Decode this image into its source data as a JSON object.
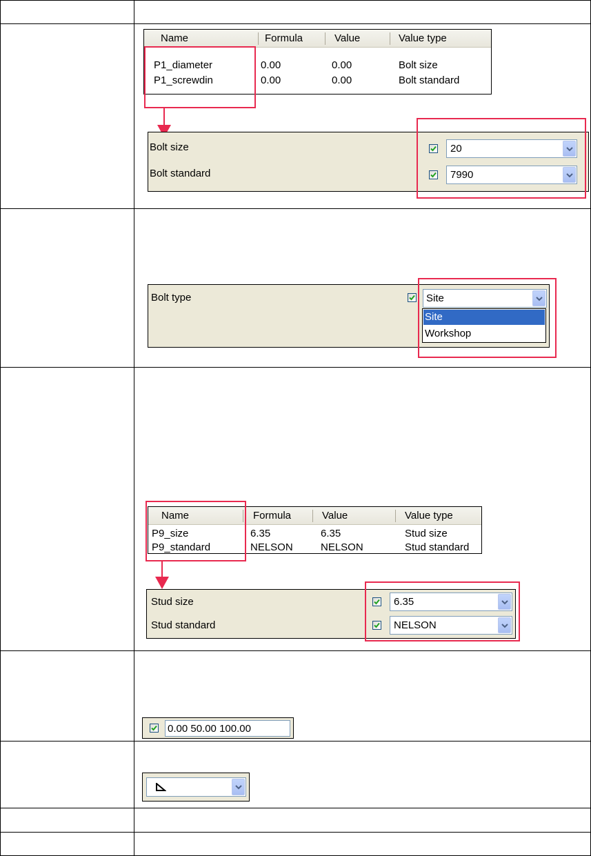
{
  "table1": {
    "headers": [
      "Name",
      "Formula",
      "Value",
      "Value type"
    ],
    "rows": [
      [
        "P1_diameter",
        "0.00",
        "0.00",
        "Bolt size"
      ],
      [
        "P1_screwdin",
        "0.00",
        "0.00",
        "Bolt standard"
      ]
    ]
  },
  "panel1": {
    "rows": [
      {
        "label": "Bolt size",
        "value": "20",
        "checked": true
      },
      {
        "label": "Bolt standard",
        "value": "7990",
        "checked": true
      }
    ]
  },
  "panel2": {
    "label": "Bolt type",
    "value": "Site",
    "checked": true,
    "options": [
      "Site",
      "Workshop"
    ],
    "selected_option": "Site"
  },
  "table2": {
    "headers": [
      "Name",
      "Formula",
      "Value",
      "Value type"
    ],
    "rows": [
      [
        "P9_size",
        "6.35",
        "6.35",
        "Stud size"
      ],
      [
        "P9_standard",
        "NELSON",
        "NELSON",
        "Stud standard"
      ]
    ]
  },
  "panel3": {
    "rows": [
      {
        "label": "Stud size",
        "value": "6.35",
        "checked": true
      },
      {
        "label": "Stud standard",
        "value": "NELSON",
        "checked": true
      }
    ]
  },
  "distance_field": {
    "value": "0.00 50.00 100.00",
    "checked": true
  },
  "profile_combo": {
    "icon": "angle-profile-icon"
  },
  "colors": {
    "highlight_box": "#e8294f",
    "arrow": "#e8294f",
    "panel_bg": "#ece9d8",
    "selection": "#316ac5"
  }
}
